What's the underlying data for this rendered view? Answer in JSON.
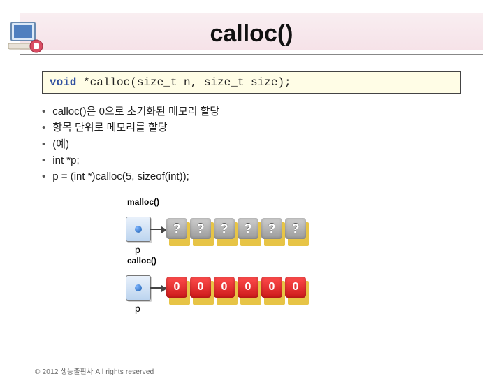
{
  "title": "calloc()",
  "signature": {
    "keyword": "void",
    "rest": " *calloc(size_t    n,    size_t     size);"
  },
  "bullets": [
    "calloc()은 0으로 초기화된 메모리 할당",
    "항목 단위로 메모리를 할당",
    "(예)",
    "int *p;",
    "p = (int *)calloc(5, sizeof(int));"
  ],
  "diagram": {
    "malloc_label": "malloc()",
    "calloc_label": "calloc()",
    "pointer_label": "p",
    "malloc_cells": [
      "?",
      "?",
      "?",
      "?",
      "?",
      "?"
    ],
    "calloc_cells": [
      "0",
      "0",
      "0",
      "0",
      "0",
      "0"
    ]
  },
  "footer": "© 2012 생능출판사 All rights reserved"
}
